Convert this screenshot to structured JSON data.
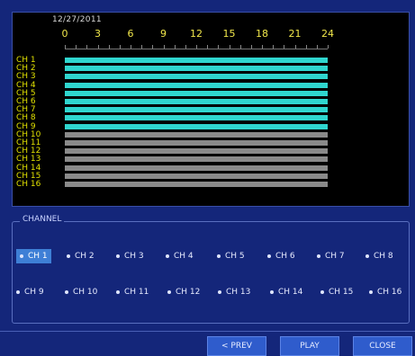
{
  "timeline": {
    "date": "12/27/2011",
    "hours": [
      "0",
      "3",
      "6",
      "9",
      "12",
      "15",
      "18",
      "21",
      "24"
    ],
    "channels": [
      "CH 1",
      "CH 2",
      "CH 3",
      "CH 4",
      "CH 5",
      "CH 6",
      "CH 7",
      "CH 8",
      "CH 9",
      "CH 10",
      "CH 11",
      "CH 12",
      "CH 13",
      "CH 14",
      "CH 15",
      "CH 16"
    ],
    "recorded": [
      true,
      true,
      true,
      true,
      true,
      true,
      true,
      true,
      true,
      false,
      false,
      false,
      false,
      false,
      false,
      false
    ],
    "colors": {
      "recorded": "#2fd6cf",
      "empty": "#8a8a8a"
    }
  },
  "channel_panel": {
    "title": "CHANNEL",
    "selected": "CH 1",
    "row1": [
      "CH 1",
      "CH 2",
      "CH 3",
      "CH 4",
      "CH 5",
      "CH 6",
      "CH 7",
      "CH 8"
    ],
    "row2": [
      "CH 9",
      "CH 10",
      "CH 11",
      "CH 12",
      "CH 13",
      "CH 14",
      "CH 15",
      "CH 16"
    ]
  },
  "buttons": {
    "prev": "< PREV",
    "play": "PLAY",
    "close": "CLOSE"
  }
}
